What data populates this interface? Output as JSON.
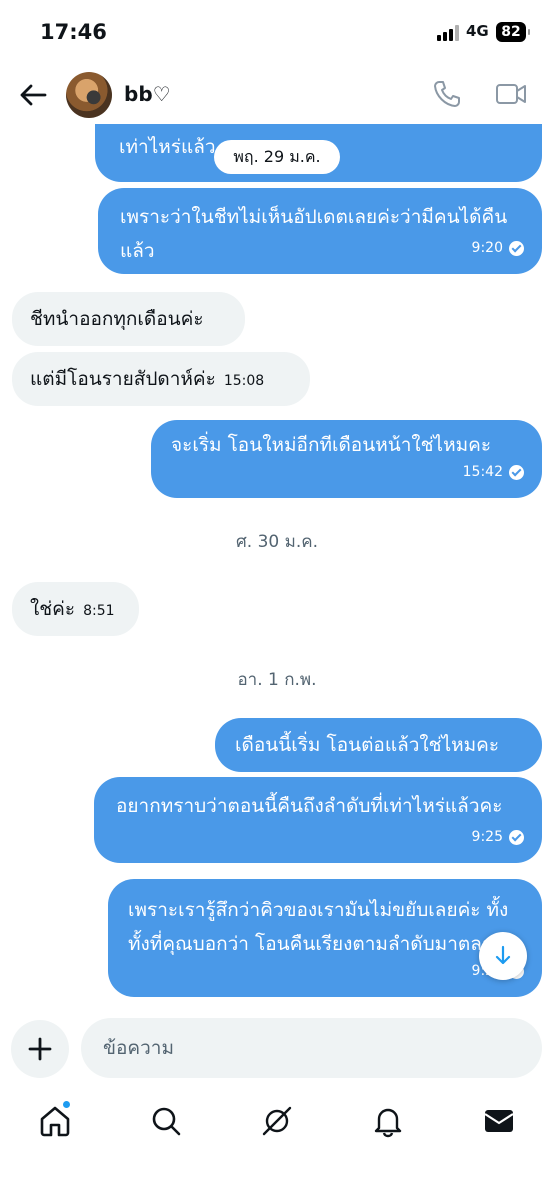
{
  "status_bar": {
    "time": "17:46",
    "network": "4G",
    "battery": "82"
  },
  "header": {
    "contact_name": "bb♡"
  },
  "messages": [
    {
      "dir": "out",
      "text": "ตอบคำถามเราหน่อยค่ะ ว่าตอนนี้คืนถึงลำดับที่เท่าไหร่แล้ว"
    },
    {
      "dir": "out",
      "text": "เพราะว่าในชีทไม่เห็นอัปเดตเลยค่ะว่ามีคนได้คืนแล้ว",
      "time": "9:20"
    },
    {
      "dir": "in",
      "text": "ชีทนำออกทุกเดือนค่ะ"
    },
    {
      "dir": "in",
      "text": "แต่มีโอนรายสัปดาห์ค่ะ",
      "time": "15:08"
    },
    {
      "dir": "out",
      "text": "จะเริ่ม โอนใหม่อีกทีเดือนหน้าใช่ไหมคะ",
      "time": "15:42"
    },
    {
      "dir": "in",
      "text": "ใช่ค่ะ",
      "time": "8:51"
    },
    {
      "dir": "out",
      "text": "เดือนนี้เริ่ม โอนต่อแล้วใช่ไหมคะ"
    },
    {
      "dir": "out",
      "text": "อยากทราบว่าตอนนี้คืนถึงลำดับที่เท่าไหร่แล้วคะ",
      "time": "9:25"
    },
    {
      "dir": "out",
      "text": "เพราะเรารู้สึกว่าคิวของเรามันไม่ขยับเลยค่ะ ทั้งทั้งที่คุณบอกว่า โอนคืนเรียงตามลำดับมาตลอด",
      "time": "9:25"
    }
  ],
  "date_separators": {
    "floating": "พฤ. 29 ม.ค.",
    "d1": "ศ. 30 ม.ค.",
    "d2": "อา. 1 ก.พ."
  },
  "composer": {
    "placeholder": "ข้อความ"
  },
  "icons": {
    "back": "arrow-left-icon",
    "call": "phone-icon",
    "video": "video-icon",
    "add": "plus-icon",
    "scroll": "arrow-down-icon",
    "home": "home-icon",
    "search": "search-icon",
    "grok": "slash-circle-icon",
    "notifications": "bell-icon",
    "messages": "envelope-icon"
  },
  "colors": {
    "outgoing": "#4a99e8",
    "incoming": "#eff3f4",
    "accent": "#1d9bf0"
  }
}
